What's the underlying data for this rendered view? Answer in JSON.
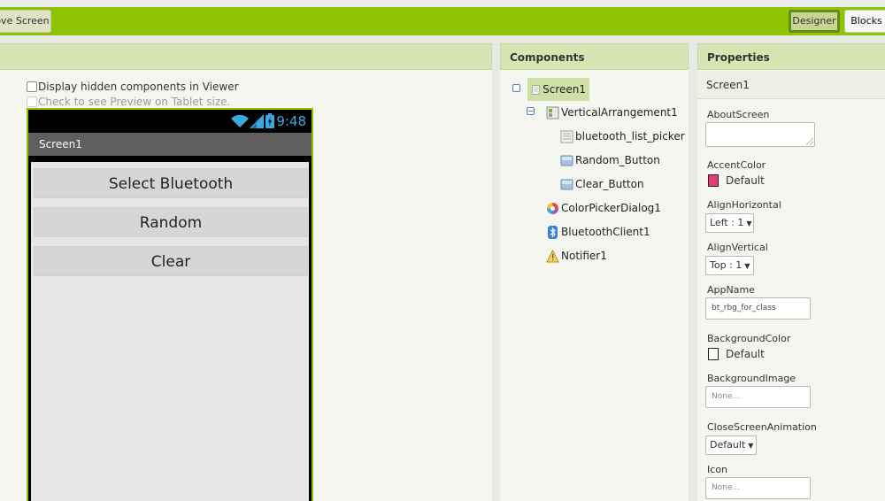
{
  "toolbar": {
    "remove_screen_label": "ove Screen",
    "designer_label": "Designer",
    "blocks_label": "Blocks"
  },
  "viewer": {
    "display_hidden_label": "Display hidden components in Viewer",
    "tablet_preview_label": "Check to see Preview on Tablet size.",
    "phone": {
      "time": "9:48",
      "screen_title": "Screen1",
      "buttons": [
        "Select Bluetooth",
        "Random",
        "Clear"
      ]
    }
  },
  "components": {
    "header": "Components",
    "items": {
      "screen": "Screen1",
      "arrangement": "VerticalArrangement1",
      "list_picker": "bluetooth_list_picker",
      "random_button": "Random_Button",
      "clear_button": "Clear_Button",
      "color_picker": "ColorPickerDialog1",
      "bluetooth_client": "BluetoothClient1",
      "notifier": "Notifier1"
    },
    "toggle_symbol": "⊟"
  },
  "properties": {
    "header": "Properties",
    "selected_component": "Screen1",
    "about_screen_label": "AboutScreen",
    "accent_color_label": "AccentColor",
    "accent_color_value": "Default",
    "accent_color_hex": "#e83c7a",
    "align_horizontal_label": "AlignHorizontal",
    "align_horizontal_value": "Left : 1",
    "align_vertical_label": "AlignVertical",
    "align_vertical_value": "Top : 1",
    "app_name_label": "AppName",
    "app_name_value": "bt_rbg_for_class",
    "background_color_label": "BackgroundColor",
    "background_color_value": "Default",
    "background_color_hex": "#ffffff",
    "background_image_label": "BackgroundImage",
    "background_image_value": "None...",
    "close_animation_label": "CloseScreenAnimation",
    "close_animation_value": "Default",
    "icon_label": "Icon",
    "icon_value": "None..."
  },
  "colors": {
    "toolbar_green": "#8fc202",
    "header_green": "#d6e5b2",
    "status_time_blue": "#39a9e0"
  }
}
